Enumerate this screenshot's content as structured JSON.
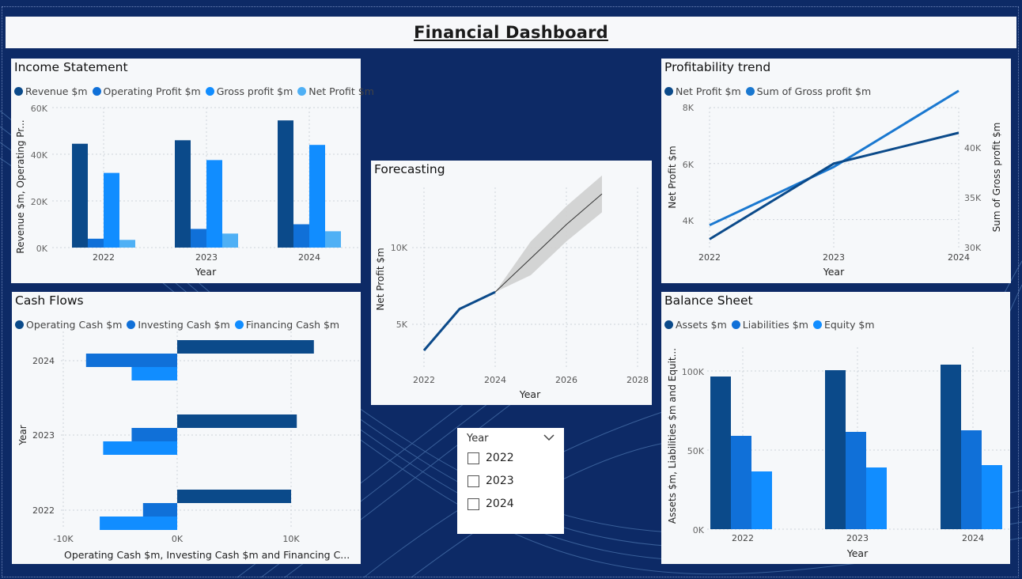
{
  "dashboard": {
    "title": "Financial Dashboard"
  },
  "colors": {
    "navy": "#0d2a66",
    "dark_blue": "#0b4a8a",
    "mid_blue": "#1070d8",
    "bright_blue": "#118dff",
    "light_blue": "#4fb0f5",
    "forecast_band": "#cfcfcf"
  },
  "income": {
    "title": "Income Statement",
    "legend": [
      "Revenue $m",
      "Operating Profit $m",
      "Gross profit $m",
      "Net Profit $m"
    ],
    "ylabel": "Revenue $m, Operating Pr...",
    "xlabel": "Year",
    "yticks": [
      "0K",
      "20K",
      "40K",
      "60K"
    ]
  },
  "profit": {
    "title": "Profitability trend",
    "legend": [
      "Net Profit $m",
      "Sum of Gross profit $m"
    ],
    "ylabel_left": "Net Profit $m",
    "ylabel_right": "Sum of Gross profit $m",
    "xlabel": "Year",
    "yticks_left": [
      "4K",
      "6K",
      "8K"
    ],
    "yticks_right": [
      "30K",
      "35K",
      "40K"
    ]
  },
  "forecast": {
    "title": "Forecasting",
    "ylabel": "Net Profit $m",
    "xlabel": "Year",
    "yticks": [
      "5K",
      "10K"
    ],
    "xticks": [
      "2022",
      "2024",
      "2026",
      "2028"
    ]
  },
  "cashflows": {
    "title": "Cash Flows",
    "legend": [
      "Operating Cash $m",
      "Investing Cash $m",
      "Financing Cash $m"
    ],
    "ylabel": "Year",
    "xlabel": "Operating Cash $m, Investing Cash $m and Financing C...",
    "xticks": [
      "-10K",
      "0K",
      "10K"
    ]
  },
  "balance": {
    "title": "Balance Sheet",
    "legend": [
      "Assets $m",
      "Liabilities $m",
      "Equity $m"
    ],
    "ylabel": "Assets $m, Liabilities $m and Equit...",
    "xlabel": "Year",
    "yticks": [
      "0K",
      "50K",
      "100K"
    ]
  },
  "slicer": {
    "label": "Year",
    "options": [
      "2022",
      "2023",
      "2024"
    ]
  },
  "chart_data": [
    {
      "id": "income",
      "type": "bar",
      "categories": [
        "2022",
        "2023",
        "2024"
      ],
      "ylim": [
        0,
        60000
      ],
      "series": [
        {
          "name": "Revenue $m",
          "values": [
            44500,
            46000,
            54500
          ]
        },
        {
          "name": "Operating Profit $m",
          "values": [
            3800,
            8000,
            10000
          ]
        },
        {
          "name": "Gross profit $m",
          "values": [
            32000,
            37500,
            44000
          ]
        },
        {
          "name": "Net Profit $m",
          "values": [
            3300,
            6000,
            7000
          ]
        }
      ]
    },
    {
      "id": "profit",
      "type": "line",
      "x": [
        "2022",
        "2023",
        "2024"
      ],
      "ylim_left": [
        3000,
        8000
      ],
      "ylim_right": [
        30000,
        42500
      ],
      "series": [
        {
          "name": "Net Profit $m",
          "axis": "left",
          "values": [
            3300,
            6000,
            7100
          ]
        },
        {
          "name": "Sum of Gross profit $m",
          "axis": "right",
          "values": [
            32000,
            37200,
            44000
          ]
        }
      ]
    },
    {
      "id": "forecast",
      "type": "line",
      "xlim": [
        2021.8,
        2028
      ],
      "ylim": [
        2000,
        15000
      ],
      "actual": {
        "x": [
          2022,
          2023,
          2024
        ],
        "values": [
          3300,
          6000,
          7100
        ]
      },
      "forecast": {
        "x": [
          2024,
          2025,
          2026,
          2027
        ],
        "values": [
          7100,
          9300,
          11500,
          13500
        ]
      },
      "band_upper": [
        7100,
        10400,
        12700,
        14700
      ],
      "band_lower": [
        7100,
        8200,
        10400,
        12300
      ]
    },
    {
      "id": "cashflows",
      "type": "bar",
      "orientation": "horizontal",
      "categories": [
        "2024",
        "2023",
        "2022"
      ],
      "xlim": [
        -10500,
        15000
      ],
      "series": [
        {
          "name": "Operating Cash $m",
          "values": [
            12000,
            10500,
            10000
          ]
        },
        {
          "name": "Investing Cash $m",
          "values": [
            -8000,
            -4000,
            -3000
          ]
        },
        {
          "name": "Financing Cash $m",
          "values": [
            -4000,
            -6500,
            -6800
          ]
        }
      ]
    },
    {
      "id": "balance",
      "type": "bar",
      "categories": [
        "2022",
        "2023",
        "2024"
      ],
      "ylim": [
        0,
        120000
      ],
      "series": [
        {
          "name": "Assets $m",
          "values": [
            96500,
            100500,
            104000
          ]
        },
        {
          "name": "Liabilities $m",
          "values": [
            59000,
            61500,
            62500
          ]
        },
        {
          "name": "Equity $m",
          "values": [
            36500,
            39000,
            40500
          ]
        }
      ]
    }
  ]
}
